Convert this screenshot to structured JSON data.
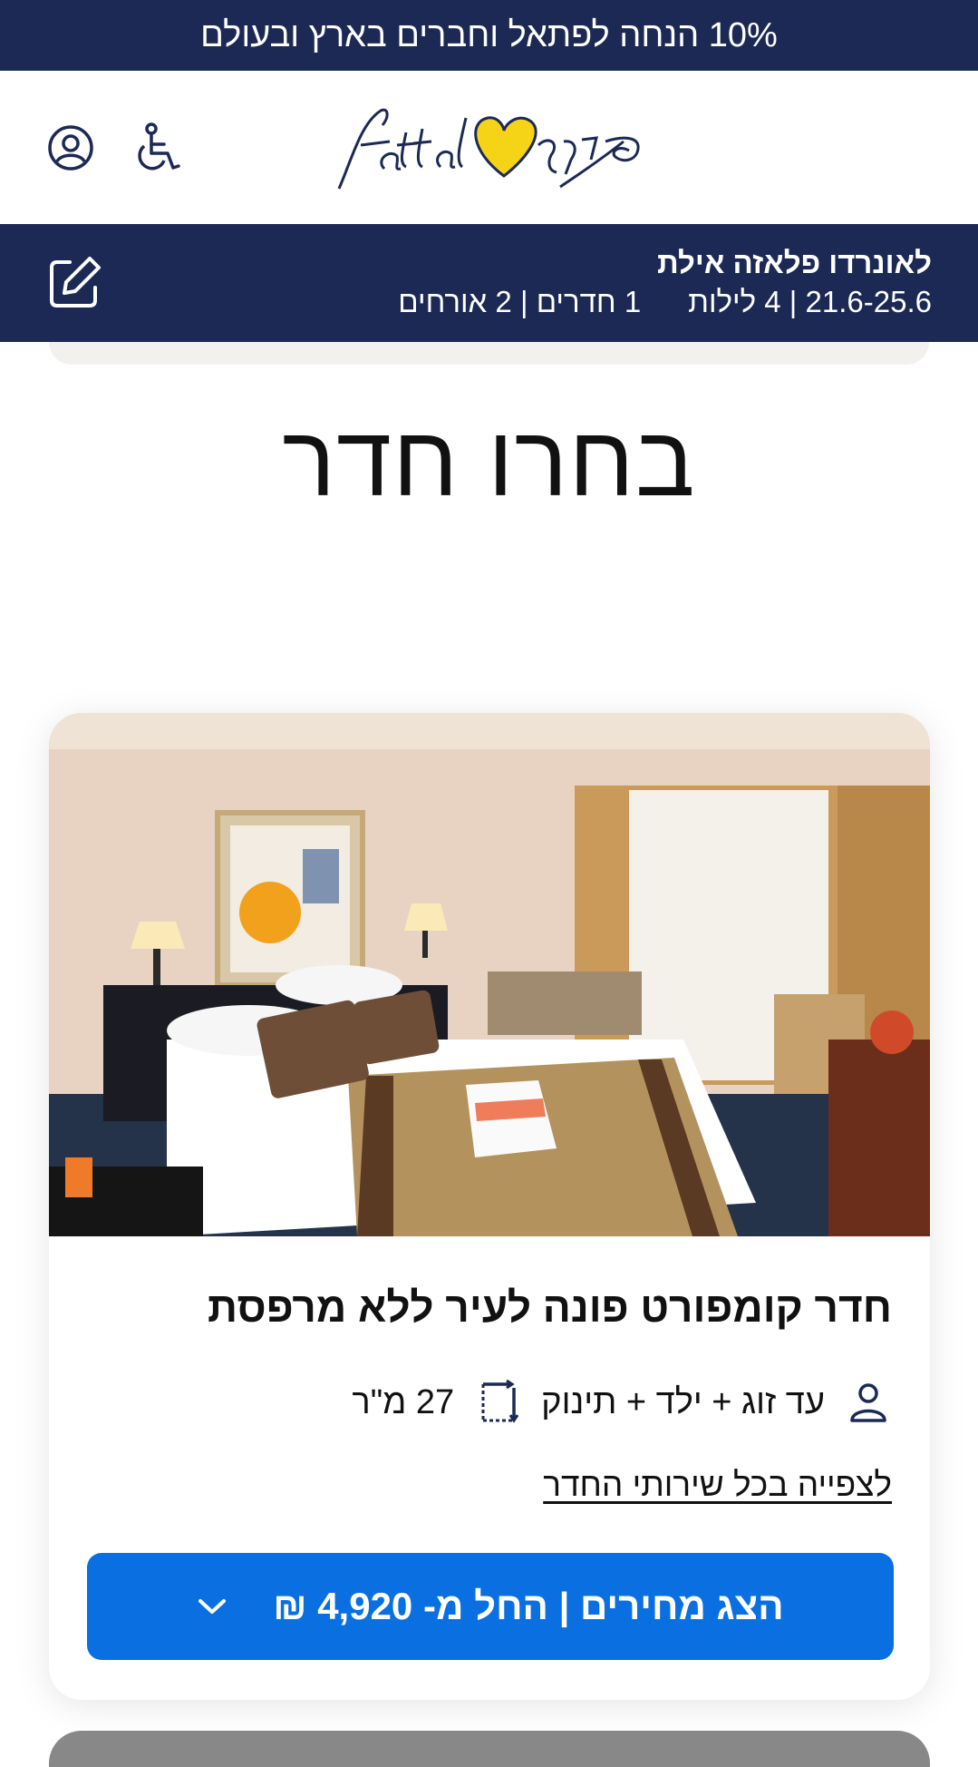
{
  "promo": {
    "text": "10% הנחה לפתאל וחברים בארץ ובעולם"
  },
  "header": {
    "logo_alt": "fattal פתאל",
    "icons": [
      "account-icon",
      "accessibility-icon"
    ]
  },
  "booking": {
    "hotel_name": "לאונרדו פלאזה אילת",
    "dates": "21.6-25.6",
    "nights": "4 לילות",
    "rooms": "1 חדרים",
    "guests": "2 אורחים",
    "edit_icon": "edit-icon"
  },
  "page": {
    "title": "בחרו חדר"
  },
  "room": {
    "name": "חדר קומפורט פונה לעיר ללא מרפסת",
    "occupancy": "עד זוג + ילד + תינוק",
    "size": "27 מ\"ר",
    "amenities_link": "לצפייה בכל שירותי החדר",
    "price_button": "הצג מחירים | החל מ- 4,920 ₪"
  },
  "colors": {
    "navy": "#1c2954",
    "primary_blue": "#0a6fe0",
    "logo_yellow": "#f5d418"
  }
}
